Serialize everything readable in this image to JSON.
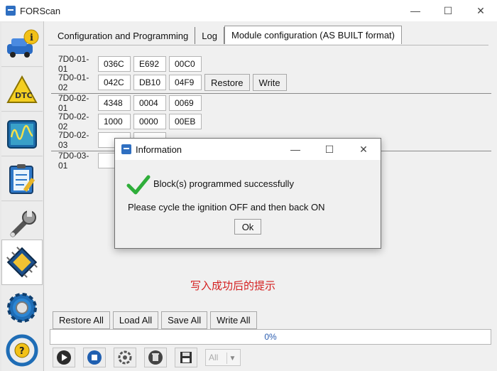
{
  "window": {
    "title": "FORScan",
    "minimize": "—",
    "maximize": "☐",
    "close": "✕"
  },
  "sidebar": {
    "items": [
      {
        "icon": "info-car-icon"
      },
      {
        "icon": "dtc-icon"
      },
      {
        "icon": "oscilloscope-icon"
      },
      {
        "icon": "checklist-icon"
      },
      {
        "icon": "wrench-icon"
      },
      {
        "icon": "chip-icon",
        "active": true
      },
      {
        "icon": "settings-gear-icon"
      },
      {
        "icon": "help-steering-icon"
      }
    ]
  },
  "tabs": [
    {
      "label": "Configuration and Programming"
    },
    {
      "label": "Log"
    },
    {
      "label": "Module configuration (AS BUILT format)",
      "active": true
    }
  ],
  "rows": [
    {
      "label": "7D0-01-01",
      "cells": [
        "036C",
        "E692",
        "00C0"
      ]
    },
    {
      "label": "7D0-01-02",
      "cells": [
        "042C",
        "DB10",
        "04F9"
      ],
      "restore": "Restore",
      "write": "Write"
    },
    {
      "label": "7D0-02-01",
      "cells": [
        "4348",
        "0004",
        "0069"
      ]
    },
    {
      "label": "7D0-02-02",
      "cells": [
        "1000",
        "0000",
        "00EB"
      ]
    },
    {
      "label": "7D0-02-03"
    },
    {
      "label": "7D0-03-01"
    }
  ],
  "annotation": "写入成功后的提示",
  "bottom_buttons": {
    "restore_all": "Restore All",
    "load_all": "Load All",
    "save_all": "Save All",
    "write_all": "Write All"
  },
  "progress": {
    "text": "0%",
    "value": 0
  },
  "toolbar": {
    "icons": [
      "play-icon",
      "stop-icon",
      "module-search-icon",
      "delete-icon",
      "save-icon"
    ],
    "select_value": "All"
  },
  "dialog": {
    "title": "Information",
    "message1": "Block(s) programmed successfully",
    "message2": "Please cycle the ignition OFF and then back ON",
    "ok": "Ok"
  },
  "colors": {
    "accent": "#2f6fc1",
    "annotation": "#d42020",
    "success": "#2fae3a"
  }
}
